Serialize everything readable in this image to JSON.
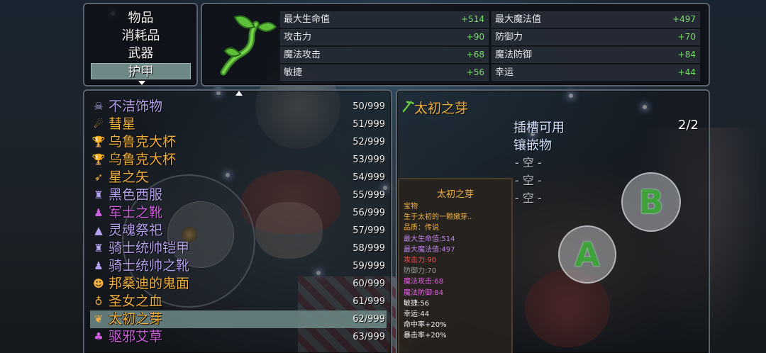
{
  "categories": {
    "items": [
      "物品",
      "消耗品",
      "武器",
      "护甲"
    ],
    "selected": 3
  },
  "stats": {
    "rows": [
      {
        "label": "最大生命值",
        "value": "+514"
      },
      {
        "label": "最大魔法值",
        "value": "+497"
      },
      {
        "label": "攻击力",
        "value": "+90"
      },
      {
        "label": "防御力",
        "value": "+70"
      },
      {
        "label": "魔法攻击",
        "value": "+68"
      },
      {
        "label": "魔法防御",
        "value": "+84"
      },
      {
        "label": "敏捷",
        "value": "+56"
      },
      {
        "label": "幸运",
        "value": "+44"
      }
    ]
  },
  "inventory": {
    "items": [
      {
        "name": "不洁饰物",
        "qty": "50/999",
        "color": "#b7a3f0",
        "icon": "skull-necklace-icon",
        "glyph": "☠"
      },
      {
        "name": "彗星",
        "qty": "51/999",
        "color": "#f0b040",
        "icon": "comet-icon",
        "glyph": "☄"
      },
      {
        "name": "乌鲁克大杯",
        "qty": "52/999",
        "color": "#f0b040",
        "icon": "trophy-icon",
        "glyph": "🏆"
      },
      {
        "name": "乌鲁克大杯",
        "qty": "53/999",
        "color": "#f0b040",
        "icon": "trophy-icon",
        "glyph": "🏆"
      },
      {
        "name": "星之矢",
        "qty": "54/999",
        "color": "#f0b040",
        "icon": "arrow-icon",
        "glyph": "➶"
      },
      {
        "name": "黑色西服",
        "qty": "55/999",
        "color": "#b7a3f0",
        "icon": "suit-icon",
        "glyph": "♜"
      },
      {
        "name": "军士之靴",
        "qty": "56/999",
        "color": "#d060e0",
        "icon": "boot-icon",
        "glyph": "♟"
      },
      {
        "name": "灵魂祭祀",
        "qty": "57/999",
        "color": "#b7a3f0",
        "icon": "wizard-hat-icon",
        "glyph": "▲"
      },
      {
        "name": "骑士统帅铠甲",
        "qty": "58/999",
        "color": "#b7a3f0",
        "icon": "armor-icon",
        "glyph": "♜"
      },
      {
        "name": "骑士统帅之靴",
        "qty": "59/999",
        "color": "#b7a3f0",
        "icon": "boot-icon",
        "glyph": "♟"
      },
      {
        "name": "邦桑迪的鬼面",
        "qty": "60/999",
        "color": "#f0b040",
        "icon": "mask-icon",
        "glyph": "☻"
      },
      {
        "name": "圣女之血",
        "qty": "61/999",
        "color": "#f0b040",
        "icon": "potion-icon",
        "glyph": "♁"
      },
      {
        "name": "太初之芽",
        "qty": "62/999",
        "color": "#f0b040",
        "icon": "sprout-icon",
        "glyph": "❦"
      },
      {
        "name": "驱邪艾草",
        "qty": "63/999",
        "color": "#d060e0",
        "icon": "herb-icon",
        "glyph": "♣"
      }
    ],
    "selected": 12
  },
  "detail": {
    "title": "太初之芽",
    "slots_label": "插槽可用",
    "inlay_label": "镶嵌物",
    "slot_count": "2/2",
    "empty_slot": "- 空 -"
  },
  "tooltip": {
    "title": "太初之芽",
    "lines": [
      {
        "text": "宝物",
        "color": "#f0b040"
      },
      {
        "text": "生于太初的一颗嫩芽..",
        "color": "#f0b040"
      },
      {
        "text": "品质：传说",
        "color": "#f0b040"
      },
      {
        "text": "最大生命值:514",
        "color": "#c080f0"
      },
      {
        "text": "最大魔法值:497",
        "color": "#c080f0"
      },
      {
        "text": "攻击力:90",
        "color": "#ff4a4a"
      },
      {
        "text": "防御力:70",
        "color": "#9a9a9a"
      },
      {
        "text": "魔法攻击:68",
        "color": "#e060e0"
      },
      {
        "text": "魔法防御:84",
        "color": "#e060e0"
      },
      {
        "text": "敏捷:56",
        "color": "#f0f0f0"
      },
      {
        "text": "幸运:44",
        "color": "#f0f0f0"
      },
      {
        "text": "命中率+20%",
        "color": "#f0f0f0"
      },
      {
        "text": "暴击率+20%",
        "color": "#f0f0f0"
      }
    ]
  },
  "controls": {
    "a_label": "A",
    "b_label": "B"
  }
}
